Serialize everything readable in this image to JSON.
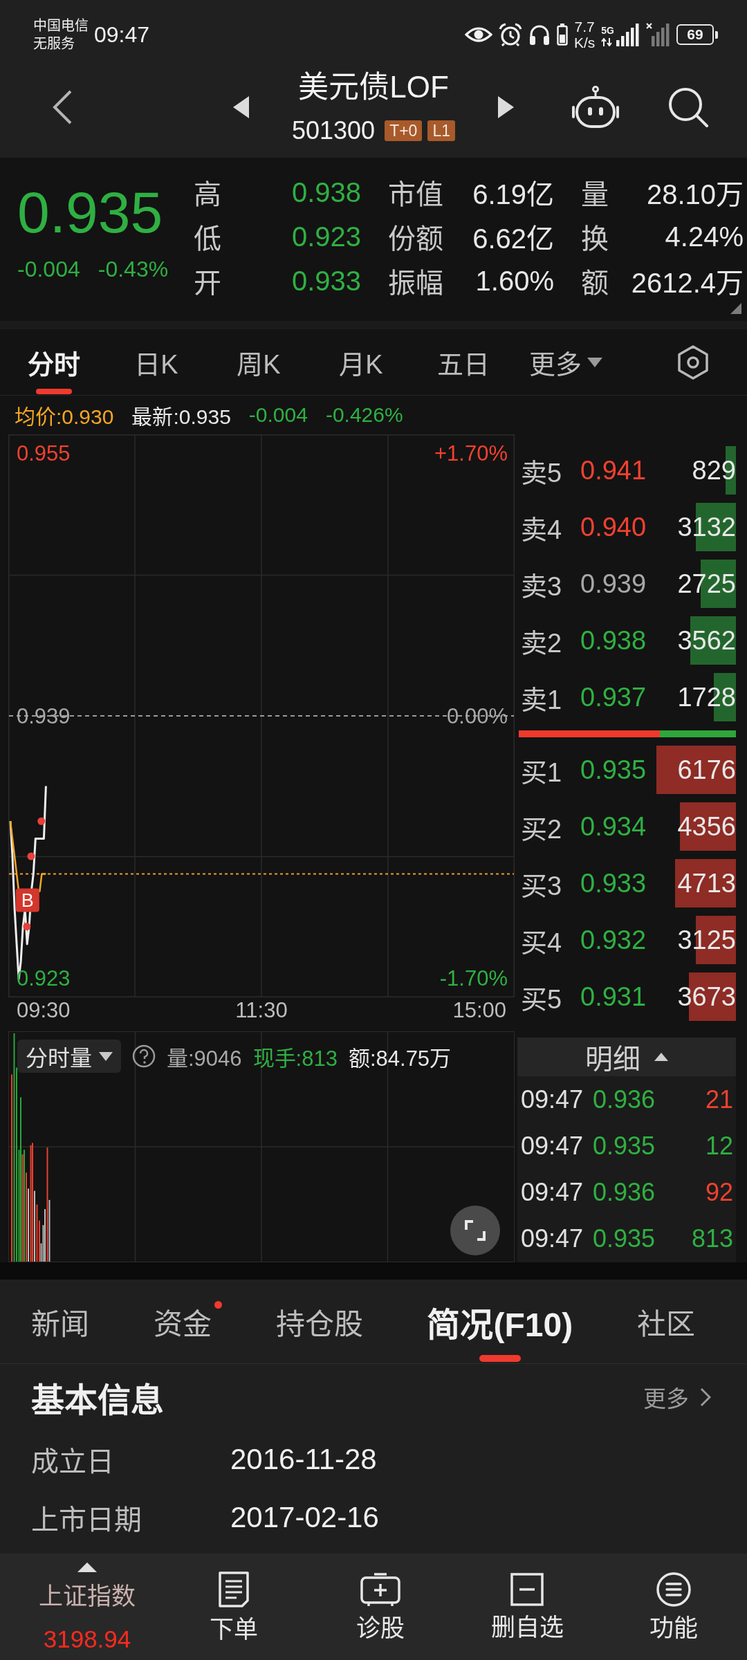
{
  "status_bar": {
    "carrier": "中国电信",
    "service": "无服务",
    "time": "09:47",
    "speed_value": "7.7",
    "speed_unit": "K/s",
    "network": "5G",
    "battery": "69"
  },
  "header": {
    "title": "美元债LOF",
    "code": "501300",
    "badges": [
      "T+0",
      "L1"
    ]
  },
  "quote": {
    "price": "0.935",
    "change": "-0.004",
    "change_percent": "-0.43%",
    "color": "#2fb042",
    "stats": [
      {
        "label": "高",
        "value": "0.938",
        "color": "#2fb042"
      },
      {
        "label": "市值",
        "value": "6.19亿",
        "color": "#e8e8e8"
      },
      {
        "label": "量",
        "value": "28.10万",
        "color": "#e8e8e8"
      },
      {
        "label": "低",
        "value": "0.923",
        "color": "#2fb042"
      },
      {
        "label": "份额",
        "value": "6.62亿",
        "color": "#e8e8e8"
      },
      {
        "label": "换",
        "value": "4.24%",
        "color": "#e8e8e8"
      },
      {
        "label": "开",
        "value": "0.933",
        "color": "#2fb042"
      },
      {
        "label": "振幅",
        "value": "1.60%",
        "color": "#e8e8e8"
      },
      {
        "label": "额",
        "value": "2612.4万",
        "color": "#e8e8e8"
      }
    ]
  },
  "chart_tabs": [
    {
      "label": "分时",
      "selected": true,
      "kind": "tab"
    },
    {
      "label": "日K",
      "selected": false,
      "kind": "tab"
    },
    {
      "label": "周K",
      "selected": false,
      "kind": "tab"
    },
    {
      "label": "月K",
      "selected": false,
      "kind": "tab"
    },
    {
      "label": "五日",
      "selected": false,
      "kind": "tab"
    },
    {
      "label": "更多",
      "selected": false,
      "kind": "menu"
    }
  ],
  "chart_info": [
    {
      "text": "均价:0.930",
      "color": "#f5a623"
    },
    {
      "text": "最新:0.935",
      "color": "#e8e8e8"
    },
    {
      "text": "-0.004",
      "color": "#2fb042"
    },
    {
      "text": "-0.426%",
      "color": "#2fb042"
    }
  ],
  "intraday_chart": {
    "price_labels": [
      {
        "text": "0.955",
        "color": "#f2412f"
      },
      {
        "text": "0.939",
        "color": "#a8a8a8"
      },
      {
        "text": "0.923",
        "color": "#2fb042"
      }
    ],
    "percent_labels": [
      {
        "text": "+1.70%",
        "color": "#f2412f"
      },
      {
        "text": "0.00%",
        "color": "#a8a8a8"
      },
      {
        "text": "-1.70%",
        "color": "#2fb042"
      }
    ],
    "trade_marker": "B",
    "time_labels": [
      "09:30",
      "11:30",
      "15:00"
    ]
  },
  "volume_chart": {
    "mode": "分时量",
    "stats": [
      {
        "text": "量:9046",
        "color": "#a8a8a8"
      },
      {
        "text": "现手:813",
        "color": "#2fb042"
      },
      {
        "text": "额:84.75万",
        "color": "#e8e8e8"
      }
    ]
  },
  "order_book": {
    "asks": [
      {
        "label": "卖5",
        "price": "0.941",
        "color": "#f2412f",
        "volume": "829"
      },
      {
        "label": "卖4",
        "price": "0.940",
        "color": "#f2412f",
        "volume": "3132"
      },
      {
        "label": "卖3",
        "price": "0.939",
        "color": "#a8a8a8",
        "volume": "2725"
      },
      {
        "label": "卖2",
        "price": "0.938",
        "color": "#2fb042",
        "volume": "3562"
      },
      {
        "label": "卖1",
        "price": "0.937",
        "color": "#2fb042",
        "volume": "1728"
      }
    ],
    "balance": {
      "level": 0.65
    },
    "bids": [
      {
        "label": "买1",
        "price": "0.935",
        "color": "#2fb042",
        "volume": "6176"
      },
      {
        "label": "买2",
        "price": "0.934",
        "color": "#2fb042",
        "volume": "4356"
      },
      {
        "label": "买3",
        "price": "0.933",
        "color": "#2fb042",
        "volume": "4713"
      },
      {
        "label": "买4",
        "price": "0.932",
        "color": "#2fb042",
        "volume": "3125"
      },
      {
        "label": "买5",
        "price": "0.931",
        "color": "#2fb042",
        "volume": "3673"
      }
    ]
  },
  "trade_detail": {
    "title": "明细",
    "rows": [
      {
        "time": "09:47",
        "price": {
          "text": "0.936",
          "color": "#2fb042"
        },
        "volume": {
          "text": "21",
          "color": "#f2412f"
        }
      },
      {
        "time": "09:47",
        "price": {
          "text": "0.935",
          "color": "#2fb042"
        },
        "volume": {
          "text": "12",
          "color": "#2fb042"
        }
      },
      {
        "time": "09:47",
        "price": {
          "text": "0.936",
          "color": "#2fb042"
        },
        "volume": {
          "text": "92",
          "color": "#f2412f"
        }
      },
      {
        "time": "09:47",
        "price": {
          "text": "0.935",
          "color": "#2fb042"
        },
        "volume": {
          "text": "813",
          "color": "#2fb042"
        }
      }
    ]
  },
  "info_tabs": [
    {
      "label": "新闻",
      "selected": false,
      "badge": false
    },
    {
      "label": "资金",
      "selected": false,
      "badge": true
    },
    {
      "label": "持仓股",
      "selected": false,
      "badge": false
    },
    {
      "label": "简况(F10)",
      "selected": true,
      "badge": false
    },
    {
      "label": "社区",
      "selected": false,
      "badge": false
    }
  ],
  "basic_info": {
    "title": "基本信息",
    "more": "更多",
    "rows": [
      {
        "label": "成立日",
        "value": "2016-11-28"
      },
      {
        "label": "上市日期",
        "value": "2017-02-16"
      }
    ]
  },
  "toolbar": {
    "index": {
      "name": "上证指数",
      "value": "3198.94",
      "color": "#ff2a1f"
    },
    "items": [
      {
        "label": "下单",
        "kind": "order"
      },
      {
        "label": "诊股",
        "kind": "diagnose"
      },
      {
        "label": "删自选",
        "kind": "remove"
      },
      {
        "label": "功能",
        "kind": "functions"
      }
    ]
  }
}
